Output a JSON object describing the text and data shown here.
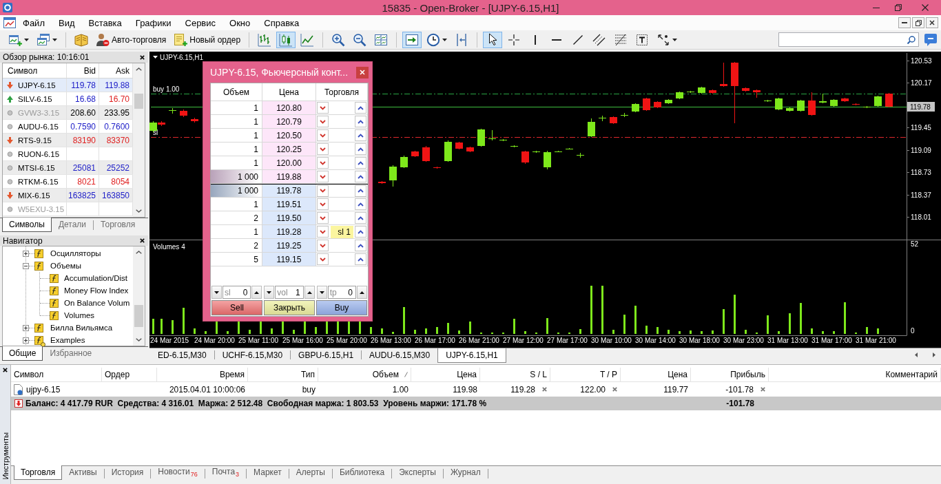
{
  "window": {
    "title": "15835 - Open-Broker - [UJPY-6.15,H1]"
  },
  "menu": [
    "Файл",
    "Вид",
    "Вставка",
    "Графики",
    "Сервис",
    "Окно",
    "Справка"
  ],
  "toolbar": [
    {
      "kind": "new-chart",
      "pressed": false,
      "dropdown": true
    },
    {
      "kind": "profiles",
      "pressed": false,
      "dropdown": true
    },
    {
      "kind": "separator"
    },
    {
      "kind": "editor",
      "pressed": false
    },
    {
      "kind": "autotrade",
      "label": "Авто-торговля",
      "pressed": false
    },
    {
      "kind": "new-order",
      "label": "Новый ордер",
      "pressed": false
    },
    {
      "kind": "separator"
    },
    {
      "kind": "bars",
      "pressed": false
    },
    {
      "kind": "candles",
      "pressed": true
    },
    {
      "kind": "line",
      "pressed": false
    },
    {
      "kind": "separator"
    },
    {
      "kind": "zoom-in",
      "pressed": false
    },
    {
      "kind": "zoom-out",
      "pressed": false
    },
    {
      "kind": "tile",
      "pressed": false
    },
    {
      "kind": "separator"
    },
    {
      "kind": "autoscroll",
      "pressed": true
    },
    {
      "kind": "periods",
      "pressed": false,
      "dropdown": true
    },
    {
      "kind": "shift",
      "pressed": false
    },
    {
      "kind": "separator"
    },
    {
      "kind": "cursor",
      "pressed": true
    },
    {
      "kind": "crosshair",
      "pressed": false
    },
    {
      "kind": "vline",
      "pressed": false
    },
    {
      "kind": "hline",
      "pressed": false
    },
    {
      "kind": "trendline",
      "pressed": false
    },
    {
      "kind": "channel",
      "pressed": false
    },
    {
      "kind": "fibo",
      "pressed": false
    },
    {
      "kind": "text",
      "pressed": false
    },
    {
      "kind": "arrows",
      "pressed": false,
      "dropdown": true
    }
  ],
  "market_watch": {
    "title": "Обзор рынка: 10:16:01",
    "columns": [
      "Символ",
      "Bid",
      "Ask"
    ],
    "rows": [
      {
        "symbol": "UJPY-6.15",
        "kind": "down",
        "bid": {
          "value": "119.78",
          "color": "#2020c8"
        },
        "ask": {
          "value": "119.88",
          "color": "#2020c8"
        },
        "selected": true,
        "disabled": false
      },
      {
        "symbol": "SILV-6.15",
        "kind": "up",
        "bid": {
          "value": "16.68",
          "color": "#2020c8"
        },
        "ask": {
          "value": "16.70",
          "color": "#e02020"
        },
        "selected": false,
        "disabled": false
      },
      {
        "symbol": "GVW3-3.15",
        "kind": "none",
        "bid": {
          "value": "208.60",
          "color": "#000000"
        },
        "ask": {
          "value": "233.95",
          "color": "#000000"
        },
        "selected": false,
        "disabled": true
      },
      {
        "symbol": "AUDU-6.15",
        "kind": "none",
        "bid": {
          "value": "0.7590",
          "color": "#2020c8"
        },
        "ask": {
          "value": "0.7600",
          "color": "#2020c8"
        },
        "selected": false,
        "disabled": false
      },
      {
        "symbol": "RTS-9.15",
        "kind": "down",
        "bid": {
          "value": "83190",
          "color": "#e02020"
        },
        "ask": {
          "value": "83370",
          "color": "#e02020"
        },
        "selected": false,
        "disabled": false
      },
      {
        "symbol": "RUON-6.15",
        "kind": "none",
        "selected": false,
        "disabled": false
      },
      {
        "symbol": "MTSI-6.15",
        "kind": "none",
        "bid": {
          "value": "25081",
          "color": "#2020c8"
        },
        "ask": {
          "value": "25252",
          "color": "#2020c8"
        },
        "selected": false,
        "disabled": false
      },
      {
        "symbol": "RTKM-6.15",
        "kind": "none",
        "bid": {
          "value": "8021",
          "color": "#e02020"
        },
        "ask": {
          "value": "8054",
          "color": "#e02020"
        },
        "selected": false,
        "disabled": false
      },
      {
        "symbol": "MIX-6.15",
        "kind": "down",
        "bid": {
          "value": "163825",
          "color": "#2020c8"
        },
        "ask": {
          "value": "163850",
          "color": "#2020c8"
        },
        "selected": false,
        "disabled": false
      },
      {
        "symbol": "W5EXU-3.15",
        "kind": "none",
        "selected": false,
        "disabled": true
      }
    ],
    "tabs": [
      {
        "label": "Символы",
        "selected": true
      },
      {
        "label": "Детали",
        "selected": false
      },
      {
        "label": "Торговля",
        "selected": false
      }
    ]
  },
  "navigator": {
    "title": "Навигатор",
    "items": [
      {
        "label": "Осцилляторы",
        "kind": "group",
        "expanded": false
      },
      {
        "label": "Объемы",
        "kind": "group",
        "expanded": true,
        "children": [
          {
            "label": "Accumulation/Dist",
            "kind": "indicator"
          },
          {
            "label": "Money Flow Index",
            "kind": "indicator"
          },
          {
            "label": "On Balance Volum",
            "kind": "indicator"
          },
          {
            "label": "Volumes",
            "kind": "indicator"
          }
        ]
      },
      {
        "label": "Билла Вильямса",
        "kind": "group",
        "expanded": false
      },
      {
        "label": "Examples",
        "kind": "custom",
        "expanded": false
      }
    ],
    "tabs": [
      {
        "label": "Общие",
        "selected": true
      },
      {
        "label": "Избранное",
        "selected": false
      }
    ]
  },
  "chart": {
    "title": "UJPY-6.15,H1",
    "order_lines": [
      {
        "kind": "buy",
        "label": "buy 1.00"
      },
      {
        "kind": "sl",
        "label": "sl"
      }
    ],
    "bid_price": "119.78",
    "price_labels": [
      "120.53",
      "120.17",
      "119.45",
      "119.09",
      "118.73",
      "118.37",
      "118.01"
    ],
    "volume_pane": {
      "title": "Volumes 4",
      "scale_labels": [
        "52",
        "0"
      ]
    },
    "time_labels": [
      "24 Mar 2015",
      "24 Mar 20:00",
      "25 Mar 11:00",
      "25 Mar 16:00",
      "25 Mar 20:00",
      "26 Mar 13:00",
      "26 Mar 17:00",
      "26 Mar 21:00",
      "27 Mar 12:00",
      "27 Mar 17:00",
      "30 Mar 10:00",
      "30 Mar 14:00",
      "30 Mar 18:00",
      "30 Mar 23:00",
      "31 Mar 13:00",
      "31 Mar 17:00",
      "31 Mar 21:00"
    ]
  },
  "order_window": {
    "title": "UJPY-6.15, Фьючерсный конт...",
    "columns": [
      "Объем",
      "Цена",
      "Торговля"
    ],
    "rows": [
      {
        "volume": "1",
        "price": "120.80",
        "kind": "ask",
        "best": false
      },
      {
        "volume": "1",
        "price": "120.79",
        "kind": "ask",
        "best": false
      },
      {
        "volume": "1",
        "price": "120.50",
        "kind": "ask",
        "best": false
      },
      {
        "volume": "1",
        "price": "120.25",
        "kind": "ask",
        "best": false
      },
      {
        "volume": "1",
        "price": "120.00",
        "kind": "ask",
        "best": false
      },
      {
        "volume": "1 000",
        "price": "119.88",
        "kind": "ask",
        "best": true
      },
      {
        "volume": "1 000",
        "price": "119.78",
        "kind": "bid",
        "best": true
      },
      {
        "volume": "1",
        "price": "119.51",
        "kind": "bid",
        "best": false
      },
      {
        "volume": "2",
        "price": "119.50",
        "kind": "bid",
        "best": false
      },
      {
        "volume": "1",
        "price": "119.28",
        "kind": "bid",
        "best": false,
        "order": "sl 1"
      },
      {
        "volume": "2",
        "price": "119.25",
        "kind": "bid",
        "best": false
      },
      {
        "volume": "5",
        "price": "119.15",
        "kind": "bid",
        "best": false
      }
    ],
    "spinners": [
      {
        "label": "sl",
        "value": "0"
      },
      {
        "label": "vol",
        "value": "1"
      },
      {
        "label": "tp",
        "value": "0"
      }
    ],
    "buttons": [
      {
        "label": "Sell",
        "kind": "sell"
      },
      {
        "label": "Закрыть",
        "kind": "close"
      },
      {
        "label": "Buy",
        "kind": "buy"
      }
    ]
  },
  "chart_tabs": [
    {
      "label": "ED-6.15,M30",
      "selected": false
    },
    {
      "label": "UCHF-6.15,M30",
      "selected": false
    },
    {
      "label": "GBPU-6.15,H1",
      "selected": false
    },
    {
      "label": "AUDU-6.15,M30",
      "selected": false
    },
    {
      "label": "UJPY-6.15,H1",
      "selected": true
    }
  ],
  "terminal": {
    "side_label": "Инструменты",
    "columns": [
      {
        "label": "Символ",
        "sorted": false
      },
      {
        "label": "Ордер",
        "sorted": false
      },
      {
        "label": "Время",
        "sorted": false
      },
      {
        "label": "Тип",
        "sorted": false
      },
      {
        "label": "Объем",
        "sorted": true
      },
      {
        "label": "Цена",
        "sorted": false
      },
      {
        "label": "S / L",
        "sorted": false
      },
      {
        "label": "T / P",
        "sorted": false
      },
      {
        "label": "Цена",
        "sorted": false
      },
      {
        "label": "Прибыль",
        "sorted": false
      },
      {
        "label": "Комментарий",
        "sorted": false
      }
    ],
    "orders": [
      {
        "symbol": "ujpy-6.15",
        "time": "2015.04.01 10:00:06",
        "type": "buy",
        "volume": "1.00",
        "price": "119.98",
        "sl": "119.28",
        "tp": "122.00",
        "current_price": "119.77",
        "profit": "-101.78"
      }
    ],
    "summary": {
      "text": "Баланс: 4 417.79 RUR  Средства: 4 316.01  Маржа: 2 512.48  Свободная маржа: 1 803.53  Уровень маржи: 171.78 %",
      "profit": "-101.78"
    },
    "tabs": [
      {
        "label": "Торговля",
        "selected": true
      },
      {
        "label": "Активы",
        "selected": false
      },
      {
        "label": "История",
        "selected": false
      },
      {
        "label": "Новости",
        "badge": "76",
        "selected": false
      },
      {
        "label": "Почта",
        "badge": "3",
        "selected": false
      },
      {
        "label": "Маркет",
        "selected": false
      },
      {
        "label": "Алерты",
        "selected": false
      },
      {
        "label": "Библиотека",
        "selected": false
      },
      {
        "label": "Эксперты",
        "selected": false
      },
      {
        "label": "Журнал",
        "selected": false
      }
    ]
  }
}
